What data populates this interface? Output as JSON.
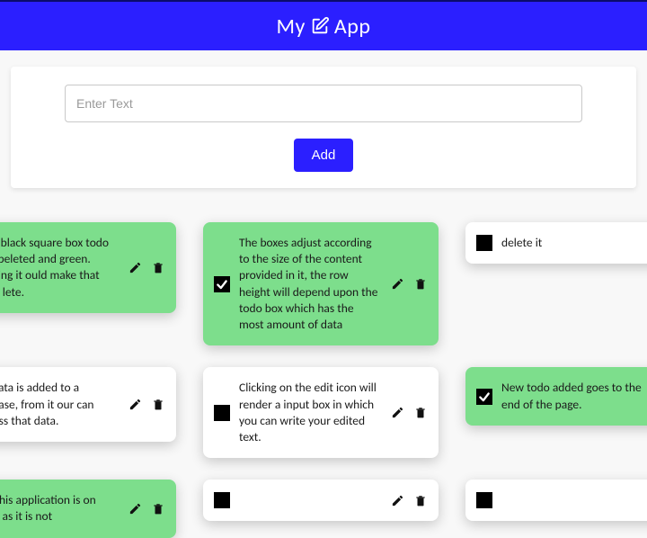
{
  "header": {
    "title_left": "My",
    "title_right": "App"
  },
  "form": {
    "placeholder": "Enter Text",
    "add_label": "Add"
  },
  "todos": [
    {
      "done": true,
      "text": "g on black square box todo compeleted and green. clicking it ould make that todo lete."
    },
    {
      "done": true,
      "text": "The boxes adjust according to the size of the content provided in it, the row height will depend upon the todo box which has the most amount of data"
    },
    {
      "done": false,
      "text": "delete it"
    },
    {
      "done": false,
      "text": "he data is added to a atabase, from it our can access that data."
    },
    {
      "done": false,
      "text": "Clicking on the edit icon will render a input box in which you can write your edited text."
    },
    {
      "done": true,
      "text": "New todo added goes to the end of the page."
    },
    {
      "done": true,
      "text": "l of this application is on AWS as it is not"
    },
    {
      "done": false,
      "text": ""
    },
    {
      "done": false,
      "text": ""
    }
  ]
}
